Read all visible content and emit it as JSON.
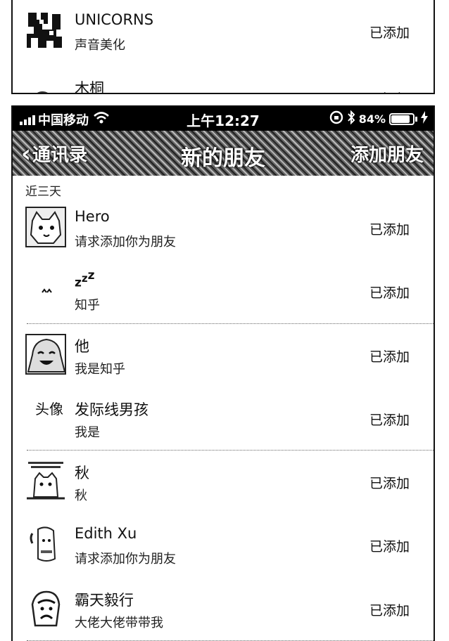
{
  "top_card": {
    "rows": [
      {
        "name": "UNICORNS",
        "message": "声音美化",
        "status": "已添加"
      },
      {
        "name": "木桐",
        "message": "",
        "status": "已添加"
      }
    ]
  },
  "status_bar": {
    "carrier": "中国移动",
    "time": "上午12:27",
    "battery": "84%"
  },
  "nav": {
    "back_label": "通讯录",
    "title": "新的朋友",
    "add_label": "添加朋友"
  },
  "section": {
    "label": "近三天"
  },
  "friends": [
    {
      "name": "Hero",
      "message": "请求添加你为朋友",
      "status": "已添加"
    },
    {
      "name": "zzz",
      "message": "知乎",
      "status": "已添加"
    },
    {
      "name": "他",
      "message": "我是知乎",
      "status": "已添加"
    },
    {
      "name": "发际线男孩",
      "message": "我是",
      "status": "已添加"
    },
    {
      "name": "秋",
      "message": "秋",
      "status": "已添加"
    },
    {
      "name": "Edith Xu",
      "message": "请求添加你为朋友",
      "status": "已添加"
    },
    {
      "name": "霸天毅行",
      "message": "大佬大佬带带我",
      "status": "已添加"
    }
  ],
  "avatar_texts": {
    "hair": "头像"
  },
  "icons": {
    "back": "chevron-left-icon",
    "wifi": "wifi-icon",
    "bluetooth": "bluetooth-icon",
    "lock": "orientation-lock-icon",
    "battery": "battery-icon",
    "charging": "charging-bolt-icon"
  }
}
